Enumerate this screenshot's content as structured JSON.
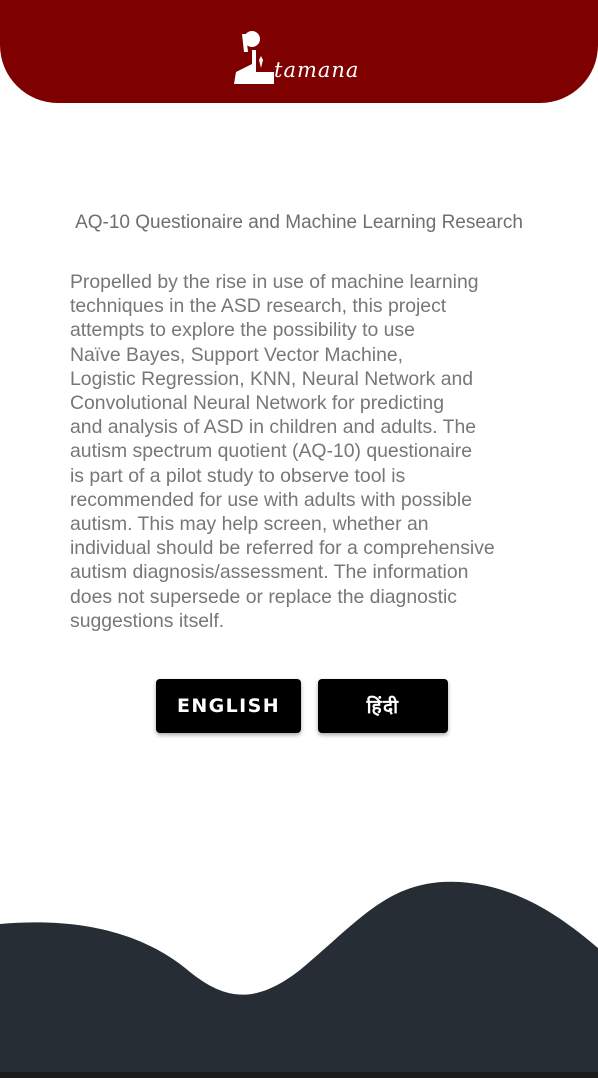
{
  "header": {
    "logo_text": "tamana",
    "logo_icon": "person-at-desk-icon",
    "background_color": "#7f0000"
  },
  "main": {
    "title": "AQ-10 Questionaire and Machine Learning Research",
    "description": "Propelled by the rise in use of machine learning\ntechniques in the ASD research, this project\nattempts  to  explore  the  possibility  to  use\nNaïve  Bayes,  Support  Vector  Machine,\nLogistic  Regression, KNN, Neural Network and\nConvolutional Neural Network for predicting\nand analysis of ASD in children and adults. The\nautism spectrum quotient (AQ-10) questionaire\nis part of a pilot study to observe tool is\nrecommended for use with adults with possible\nautism. This may help screen, whether an\nindividual should be referred for a comprehensive\nautism diagnosis/assessment. The information\ndoes not supersede or replace the diagnostic\nsuggestions itself."
  },
  "buttons": {
    "english_label": "ENGLISH",
    "hindi_label": "हिंदी"
  },
  "footer": {
    "wave_color": "#262d35"
  }
}
